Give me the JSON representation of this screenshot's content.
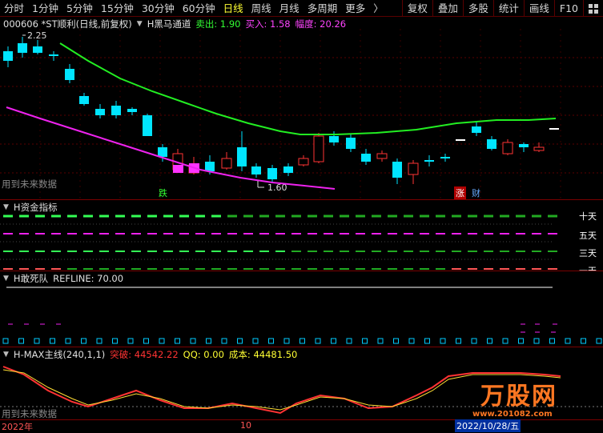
{
  "toolbar": {
    "periods": [
      "分时",
      "1分钟",
      "5分钟",
      "15分钟",
      "30分钟",
      "60分钟",
      "日线",
      "周线",
      "月线",
      "多周期",
      "更多"
    ],
    "active_period": "日线",
    "more_arrow": "〉",
    "right_buttons": [
      "复权",
      "叠加",
      "多股",
      "统计",
      "画线",
      "F10"
    ],
    "grid_icon": "grid-icon"
  },
  "main": {
    "code_name": "000606 *ST顺利(日线,前复权)",
    "indicator": "H黑马通道",
    "sell_label": "卖出: 1.90",
    "buy_label": "买入: 1.58",
    "amp_label": "幅度: 20.26",
    "high_mark": "2.25",
    "low_mark": "1.60",
    "future_note": "用到未来数据",
    "signal_fall": "跌",
    "signal_rise": "涨",
    "signal_cai": "财"
  },
  "fund": {
    "title": "H资金指标",
    "labels": [
      "十天",
      "五天",
      "三天",
      "一天"
    ]
  },
  "dare": {
    "title": "H敢死队",
    "refline": "REFLINE: 70.00"
  },
  "hmax": {
    "title": "H-MAX主线(240,1,1)",
    "breakout": "突破: 44542.22",
    "qq": "QQ: 0.00",
    "cost": "成本: 44481.50",
    "future_note": "用到未来数据"
  },
  "axis": {
    "year_start": "2022年",
    "month_mark": "10",
    "date_end": "2022/10/28/五"
  },
  "watermark": {
    "text": "万股网",
    "url": "www.201082.com"
  },
  "colors": {
    "up": "#ff4444",
    "down": "#00e5ff",
    "green_line": "#22ee22",
    "magenta_line": "#ee22ee"
  }
}
